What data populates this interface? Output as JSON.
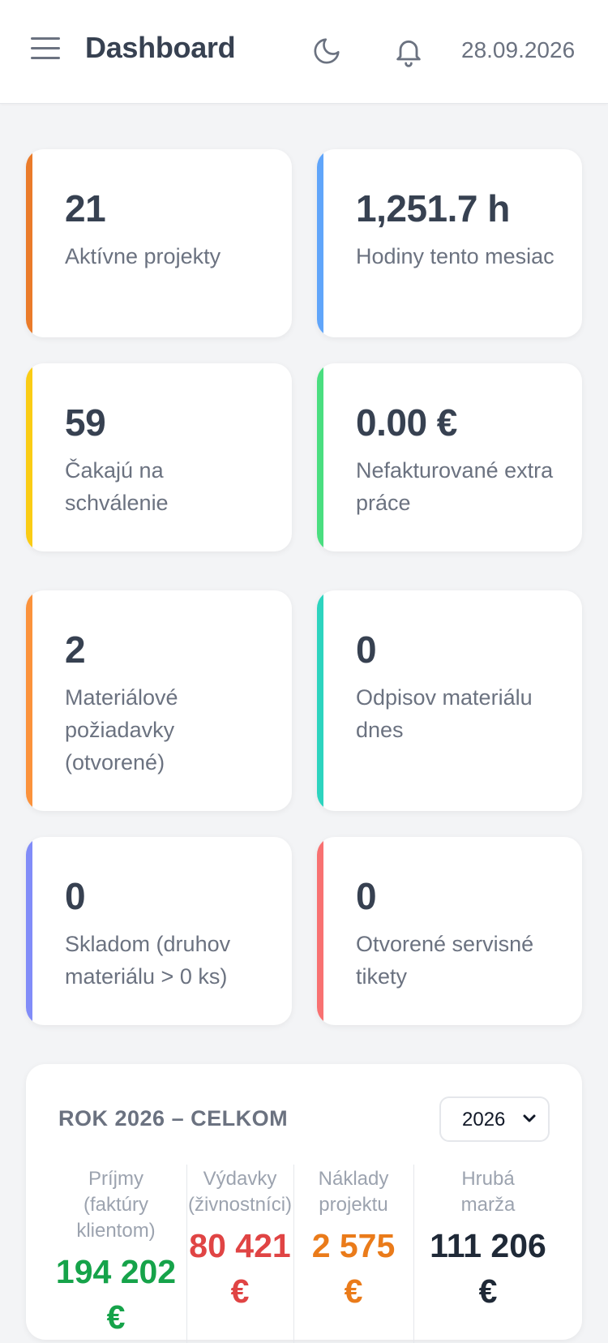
{
  "header": {
    "title": "Dashboard",
    "date": "28.09.2026"
  },
  "icons": {
    "menu": "hamburger-icon",
    "theme": "moon-icon",
    "notifications": "bell-icon"
  },
  "cards": [
    {
      "value": "21",
      "label": "Aktívne projekty",
      "color": "#ea7b2a"
    },
    {
      "value": "1,251.7 h",
      "label": "Hodiny tento mesiac",
      "color": "#60a5fa"
    },
    {
      "value": "59",
      "label": "Čakajú na schválenie",
      "color": "#facc15"
    },
    {
      "value": "0.00 €",
      "label": "Nefakturované extra práce",
      "color": "#4ade80"
    },
    {
      "value": "2",
      "label": "Materiálové požiadavky (otvorené)",
      "color": "#fb923c"
    },
    {
      "value": "0",
      "label": "Odpisov materiálu dnes",
      "color": "#2dd4bf"
    },
    {
      "value": "0",
      "label": "Skladom (druhov materiálu > 0 ks)",
      "color": "#818cf8"
    },
    {
      "value": "0",
      "label": "Otvorené servisné tikety",
      "color": "#f87171"
    }
  ],
  "summary": {
    "title": "ROK 2026 – CELKOM",
    "year_selected": "2026",
    "columns": [
      {
        "label_line1": "Príjmy",
        "label_line2": "(faktúry",
        "label_line3": "klientom)",
        "value": "194 202",
        "currency": "€",
        "color": "#16a34a"
      },
      {
        "label_line1": "Výdavky",
        "label_line2": "(živnostníci)",
        "label_line3": "",
        "value": "80 421",
        "currency": "€",
        "color": "#e04444"
      },
      {
        "label_line1": "Náklady",
        "label_line2": "projektu",
        "label_line3": "",
        "value": "2 575",
        "currency": "€",
        "color": "#ea7b1a"
      },
      {
        "label_line1": "Hrubá",
        "label_line2": "marža",
        "label_line3": "",
        "value": "111 206",
        "currency": "€",
        "color": "#1f2937"
      }
    ]
  }
}
